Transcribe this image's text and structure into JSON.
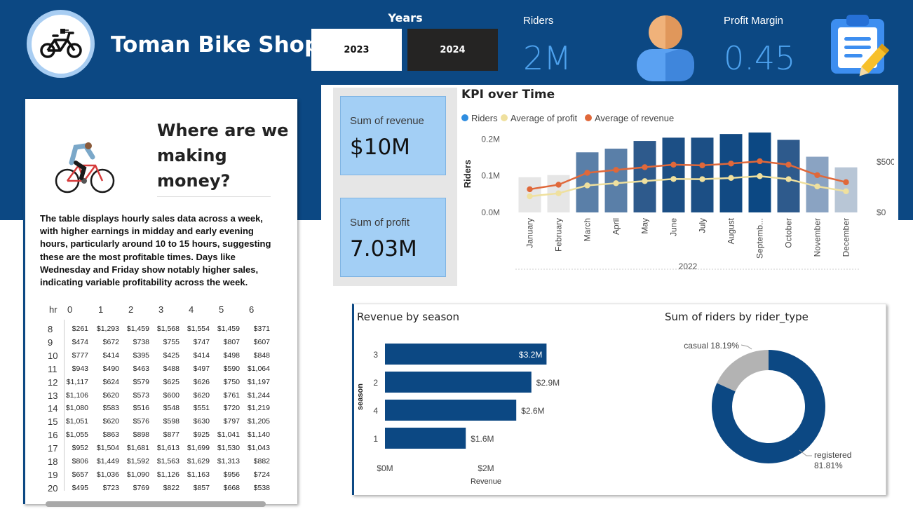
{
  "header": {
    "title": "Toman Bike Shop",
    "years_title": "Years",
    "years": [
      "2023",
      "2024"
    ],
    "riders_label": "Riders",
    "riders_value": "2M",
    "profit_margin_label": "Profit Margin",
    "profit_margin_value": "0.45"
  },
  "icons": {
    "logo": "bike-plug-icon",
    "riders": "person-icon",
    "margin": "clipboard-pencil-icon",
    "cyclist": "cyclist-illustration"
  },
  "colors": {
    "banner": "#0c4883",
    "accent_blue": "#4ea2ee",
    "tile": "#a3cff5",
    "dark_bar": "#0c4883",
    "orange": "#e0683a",
    "yellow": "#efe09e",
    "grey_slice": "#b3b3b3"
  },
  "left_panel": {
    "heading": "Where are we making money?",
    "description": "The table displays hourly sales data across a week, with higher earnings in midday and early evening hours, particularly around 10 to 15 hours, suggesting these are the most profitable times. Days like Wednesday and Friday show notably higher sales, indicating variable profitability across the week.",
    "table": {
      "row_header": "hr",
      "columns": [
        "0",
        "1",
        "2",
        "3",
        "4",
        "5",
        "6"
      ],
      "rows": [
        {
          "hr": "8",
          "cells": [
            "$261",
            "$1,293",
            "$1,459",
            "$1,568",
            "$1,554",
            "$1,459",
            "$371"
          ]
        },
        {
          "hr": "9",
          "cells": [
            "$474",
            "$672",
            "$738",
            "$755",
            "$747",
            "$807",
            "$607"
          ]
        },
        {
          "hr": "10",
          "cells": [
            "$777",
            "$414",
            "$395",
            "$425",
            "$414",
            "$498",
            "$848"
          ]
        },
        {
          "hr": "11",
          "cells": [
            "$943",
            "$490",
            "$463",
            "$488",
            "$497",
            "$590",
            "$1,064"
          ]
        },
        {
          "hr": "12",
          "cells": [
            "$1,117",
            "$624",
            "$579",
            "$625",
            "$626",
            "$750",
            "$1,197"
          ]
        },
        {
          "hr": "13",
          "cells": [
            "$1,106",
            "$620",
            "$573",
            "$600",
            "$620",
            "$761",
            "$1,244"
          ]
        },
        {
          "hr": "14",
          "cells": [
            "$1,080",
            "$583",
            "$516",
            "$548",
            "$551",
            "$720",
            "$1,219"
          ]
        },
        {
          "hr": "15",
          "cells": [
            "$1,051",
            "$620",
            "$576",
            "$598",
            "$630",
            "$797",
            "$1,205"
          ]
        },
        {
          "hr": "16",
          "cells": [
            "$1,055",
            "$863",
            "$898",
            "$877",
            "$925",
            "$1,041",
            "$1,140"
          ]
        },
        {
          "hr": "17",
          "cells": [
            "$952",
            "$1,504",
            "$1,681",
            "$1,613",
            "$1,699",
            "$1,530",
            "$1,043"
          ]
        },
        {
          "hr": "18",
          "cells": [
            "$806",
            "$1,449",
            "$1,592",
            "$1,563",
            "$1,629",
            "$1,313",
            "$882"
          ]
        },
        {
          "hr": "19",
          "cells": [
            "$657",
            "$1,036",
            "$1,090",
            "$1,126",
            "$1,163",
            "$956",
            "$724"
          ]
        },
        {
          "hr": "20",
          "cells": [
            "$495",
            "$723",
            "$769",
            "$822",
            "$857",
            "$668",
            "$538"
          ]
        }
      ]
    }
  },
  "tiles": {
    "revenue_label": "Sum of revenue",
    "revenue_value": "$10M",
    "profit_label": "Sum of profit",
    "profit_value": "7.03M"
  },
  "chart_data": [
    {
      "type": "bar",
      "title": "KPI over Time",
      "legend_position": "top-left",
      "categories": [
        "January",
        "February",
        "March",
        "April",
        "May",
        "June",
        "July",
        "August",
        "Septemb...",
        "October",
        "November",
        "December"
      ],
      "xlabel": "2022",
      "ylabel": "Riders",
      "ylim": [
        0,
        220000
      ],
      "y_ticks": [
        "0.0M",
        "0.1M",
        "0.2M"
      ],
      "y_tick_values": [
        0,
        100000,
        200000
      ],
      "y2lim": [
        0,
        800
      ],
      "y2_ticks": [
        "$0",
        "$500"
      ],
      "y2_tick_values": [
        0,
        500
      ],
      "series": [
        {
          "name": "Riders",
          "kind": "bar",
          "values": [
            96000,
            102000,
            164000,
            174000,
            195000,
            204000,
            204000,
            214000,
            218000,
            198000,
            152000,
            123000
          ],
          "colors": [
            "#e6e6e6",
            "#e6e6e6",
            "#5a7fa8",
            "#5a7fa8",
            "#2e5a8c",
            "#1c4f85",
            "#1c4f85",
            "#124a83",
            "#0c4883",
            "#2e5a8c",
            "#8aa3c2",
            "#b8c6d6"
          ]
        },
        {
          "name": "Average of profit",
          "kind": "line",
          "axis": "right",
          "values": [
            160,
            190,
            268,
            290,
            311,
            332,
            330,
            342,
            360,
            330,
            258,
            210
          ]
        },
        {
          "name": "Average of revenue",
          "kind": "line",
          "axis": "right",
          "values": [
            230,
            275,
            393,
            422,
            449,
            474,
            467,
            485,
            508,
            474,
            370,
            300
          ]
        }
      ]
    },
    {
      "type": "bar",
      "orientation": "horizontal",
      "title": "Revenue by season",
      "categories": [
        "3",
        "2",
        "4",
        "1"
      ],
      "values": [
        3.2,
        2.9,
        2.6,
        1.6
      ],
      "data_labels": [
        "$3.2M",
        "$2.9M",
        "$2.6M",
        "$1.6M"
      ],
      "xlabel": "Revenue",
      "ylabel": "season",
      "xlim": [
        0,
        3.6
      ],
      "x_ticks": [
        "$0M",
        "$2M"
      ],
      "x_tick_values": [
        0,
        2
      ]
    },
    {
      "type": "pie",
      "style": "donut",
      "title": "Sum of riders by rider_type",
      "categories": [
        "casual",
        "registered"
      ],
      "values": [
        18.19,
        81.81
      ],
      "labels": [
        "casual 18.19%",
        "registered",
        "81.81%"
      ]
    }
  ]
}
